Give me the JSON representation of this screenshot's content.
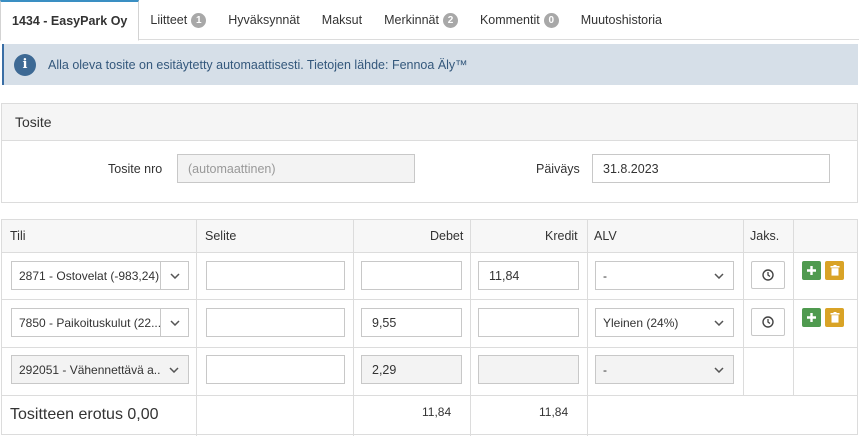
{
  "tabs": [
    {
      "label": "1434 - EasyPark Oy",
      "badge": null,
      "active": true
    },
    {
      "label": "Liitteet",
      "badge": "1"
    },
    {
      "label": "Hyväksynnät",
      "badge": null
    },
    {
      "label": "Maksut",
      "badge": null
    },
    {
      "label": "Merkinnät",
      "badge": "2"
    },
    {
      "label": "Kommentit",
      "badge": "0"
    },
    {
      "label": "Muutoshistoria",
      "badge": null
    }
  ],
  "info": {
    "icon": "info-icon",
    "text": "Alla oleva tosite on esitäytetty automaattisesti. Tietojen lähde: Fennoa Äly™"
  },
  "tosite": {
    "title": "Tosite",
    "number_label": "Tosite nro",
    "number_placeholder": "(automaattinen)",
    "date_label": "Päiväys",
    "date_value": "31.8.2023"
  },
  "grid": {
    "headers": {
      "account": "Tili",
      "description": "Selite",
      "debit": "Debet",
      "credit": "Kredit",
      "vat": "ALV",
      "period": "Jaks."
    },
    "rows": [
      {
        "account": "2871 - Ostovelat (-983,24)",
        "description": "",
        "debit": "",
        "credit": "11,84",
        "vat": "-"
      },
      {
        "account": "7850 - Paikoituskulut (22...",
        "description": "",
        "debit": "9,55",
        "credit": "",
        "vat": "Yleinen (24%)"
      },
      {
        "account": "292051 - Vähennettävä a...",
        "description": "",
        "debit": "2,29",
        "credit": "",
        "vat": "-"
      }
    ],
    "footer": {
      "difference_label": "Tositteen erotus 0,00",
      "debit_total": "11,84",
      "credit_total": "11,84"
    }
  },
  "colors": {
    "accent": "#3a8fc3",
    "info_bg": "#d6dfe8",
    "add_green": "#4f9a4f",
    "delete_gold": "#d9a326"
  }
}
